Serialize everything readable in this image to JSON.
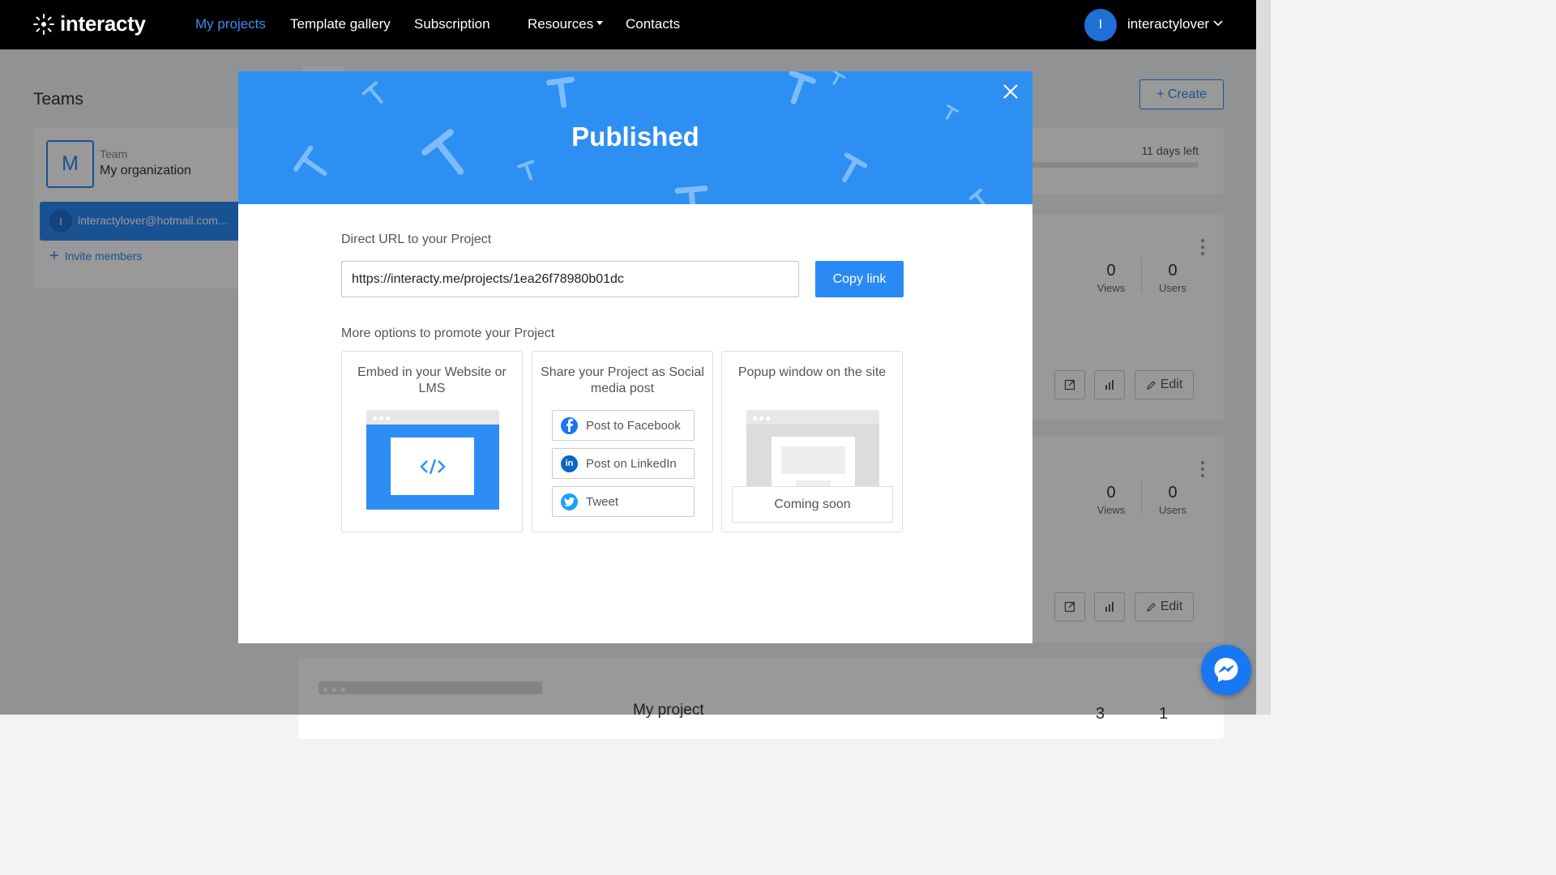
{
  "navbar": {
    "logo_text": "interacty",
    "items": [
      {
        "label": "My projects",
        "active": true
      },
      {
        "label": "Template gallery"
      },
      {
        "label": "Subscription"
      },
      {
        "label": "Resources"
      },
      {
        "label": "Contacts"
      }
    ],
    "user": {
      "initial": "I",
      "name": "interactylover"
    }
  },
  "sidebar": {
    "title": "Teams",
    "team": {
      "avatar": "M",
      "label": "Team",
      "name": "My organization"
    },
    "member": {
      "initial": "I",
      "email": "interactylover@hotmail.com..."
    },
    "invite_label": "Invite members"
  },
  "main": {
    "create_label": "+ Create",
    "trial_text": "11 days left",
    "projects": [
      {
        "views": "0",
        "views_label": "Views",
        "users": "0",
        "users_label": "Users",
        "edit_label": "Edit"
      },
      {
        "views": "0",
        "views_label": "Views",
        "users": "0",
        "users_label": "Users",
        "edit_label": "Edit"
      }
    ],
    "bottom_project": {
      "title": "My project",
      "views": "3",
      "users": "1"
    }
  },
  "modal": {
    "title": "Published",
    "url_label": "Direct URL to your Project",
    "url_value": "https://interacty.me/projects/1ea26f78980b01dc",
    "copy_label": "Copy link",
    "more_label": "More options to promote your Project",
    "options": {
      "embed_title": "Embed in your Website or LMS",
      "social_title": "Share your Project as Social media post",
      "popup_title": "Popup window on the site",
      "social_buttons": [
        "Post to Facebook",
        "Post on LinkedIn",
        "Tweet"
      ],
      "coming_soon": "Coming soon"
    }
  },
  "colors": {
    "accent": "#2e8ff2",
    "navbar": "#000000",
    "facebook": "#1877f2",
    "linkedin": "#0a66c2",
    "twitter": "#1da1f2"
  }
}
